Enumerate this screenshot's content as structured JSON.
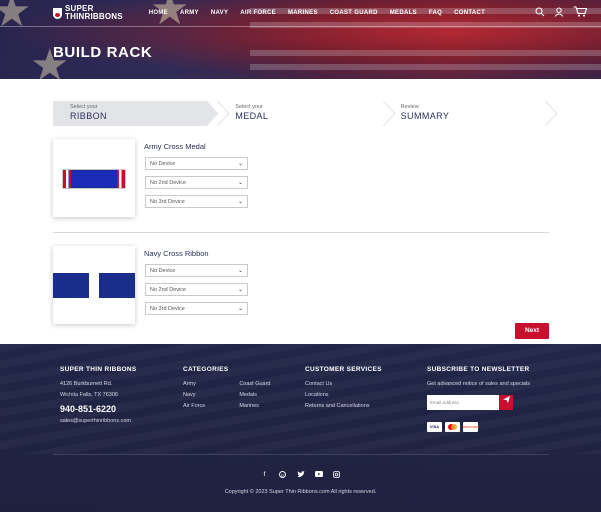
{
  "header": {
    "logo_line1": "SUPER",
    "logo_line2": "THINRIBBONS",
    "menu": [
      "HOME",
      "ARMY",
      "NAVY",
      "AIR FORCE",
      "MARINES",
      "COAST GUARD",
      "MEDALS",
      "FAQ",
      "CONTACT"
    ],
    "icons": [
      "search-icon",
      "user-icon",
      "cart-icon"
    ],
    "page_title": "BUILD RACK"
  },
  "steps": [
    {
      "small": "Select your",
      "big": "RIBBON"
    },
    {
      "small": "Select your",
      "big": "MEDAL"
    },
    {
      "small": "Review",
      "big": "SUMMARY"
    }
  ],
  "items": [
    {
      "name": "Army Cross Medal",
      "selects": [
        "No Device",
        "No 2nd Device",
        "No 3rd Device"
      ],
      "ribbon_colors": {
        "edge": "#c8102e",
        "white": "#ffffff",
        "center": "#1a2bb8"
      }
    },
    {
      "name": "Navy Cross Ribbon",
      "selects": [
        "No Device",
        "No 2nd Device",
        "No 3rd Device"
      ],
      "ribbon_colors": {
        "main": "#1a2f8f",
        "stripe": "#ffffff"
      }
    }
  ],
  "next_label": "Next",
  "footer": {
    "company": {
      "title": "SUPER THIN RIBBONS",
      "address1": "4126 Burkburnett Rd.",
      "address2": "Wichita Falls, TX 76306",
      "phone": "940-851-6220",
      "email": "sales@superthinribbons.com"
    },
    "categories": {
      "title": "CATEGORIES",
      "col1": [
        "Army",
        "Navy",
        "Air Force"
      ],
      "col2": [
        "Coast Guard",
        "Medals",
        "Marines"
      ]
    },
    "customer_services": {
      "title": "CUSTOMER SERVICES",
      "links": [
        "Contact Us",
        "Locations",
        "Returns and Cancellations"
      ]
    },
    "newsletter": {
      "title": "SUBSCRIBE TO NEWSLETTER",
      "text": "Get advanced notice of sales and specials",
      "placeholder": "Email Address",
      "cards": [
        "VISA",
        "MC",
        "DISCOVER"
      ]
    },
    "socials": [
      "facebook-icon",
      "pinterest-icon",
      "twitter-icon",
      "youtube-icon",
      "instagram-icon"
    ],
    "copyright": "Copyright © 2023 Super Thin Ribbons.com All rights reserved."
  },
  "colors": {
    "accent": "#c8102e",
    "navy": "#2a2f5a"
  }
}
